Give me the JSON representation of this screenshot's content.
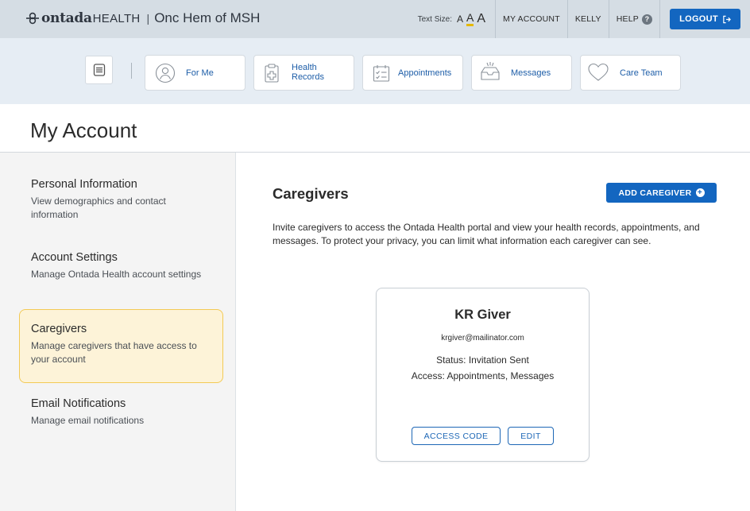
{
  "header": {
    "logo_word": "ontada",
    "logo_health": "HEALTH",
    "separator": "|",
    "org": "Onc Hem of MSH",
    "text_size": {
      "label": "Text Size:",
      "options": [
        "A",
        "A",
        "A"
      ]
    },
    "links": {
      "my_account": "MY ACCOUNT",
      "user": "KELLY",
      "help": "HELP"
    },
    "help_glyph": "?",
    "logout": "LOGOUT"
  },
  "nav": {
    "tiles": [
      {
        "label": "For Me",
        "icon": "user-icon"
      },
      {
        "label": "Health",
        "label2": "Records",
        "icon": "clipboard-icon"
      },
      {
        "label": "Appointments",
        "icon": "calendar-icon"
      },
      {
        "label": "Messages",
        "icon": "inbox-icon"
      },
      {
        "label": "Care Team",
        "icon": "heart-icon"
      }
    ]
  },
  "page": {
    "title": "My Account"
  },
  "sidebar": {
    "items": [
      {
        "title": "Personal Information",
        "desc": "View demographics and contact information",
        "active": false
      },
      {
        "title": "Account Settings",
        "desc": "Manage Ontada Health account settings",
        "active": false
      },
      {
        "title": "Caregivers",
        "desc": "Manage caregivers that have access to your account",
        "active": true
      },
      {
        "title": "Email Notifications",
        "desc": "Manage email notifications",
        "active": false
      }
    ]
  },
  "main": {
    "title": "Caregivers",
    "add_button": "ADD CAREGIVER",
    "add_glyph": "+",
    "intro": "Invite caregivers to access the Ontada Health portal and view your health records, appointments, and messages. To protect your privacy, you can limit what information each caregiver can see.",
    "caregiver": {
      "name": "KR Giver",
      "email": "krgiver@mailinator.com",
      "status_label": "Status:",
      "status_value": "Invitation Sent",
      "access_label": "Access:",
      "access_value": "Appointments, Messages",
      "access_code_button": "ACCESS CODE",
      "edit_button": "EDIT"
    }
  },
  "colors": {
    "accent": "#1366c0",
    "topbar": "#d5dde4",
    "navband": "#e6edf4",
    "active_bg": "#fdf3d8",
    "active_border": "#f3ca55"
  }
}
